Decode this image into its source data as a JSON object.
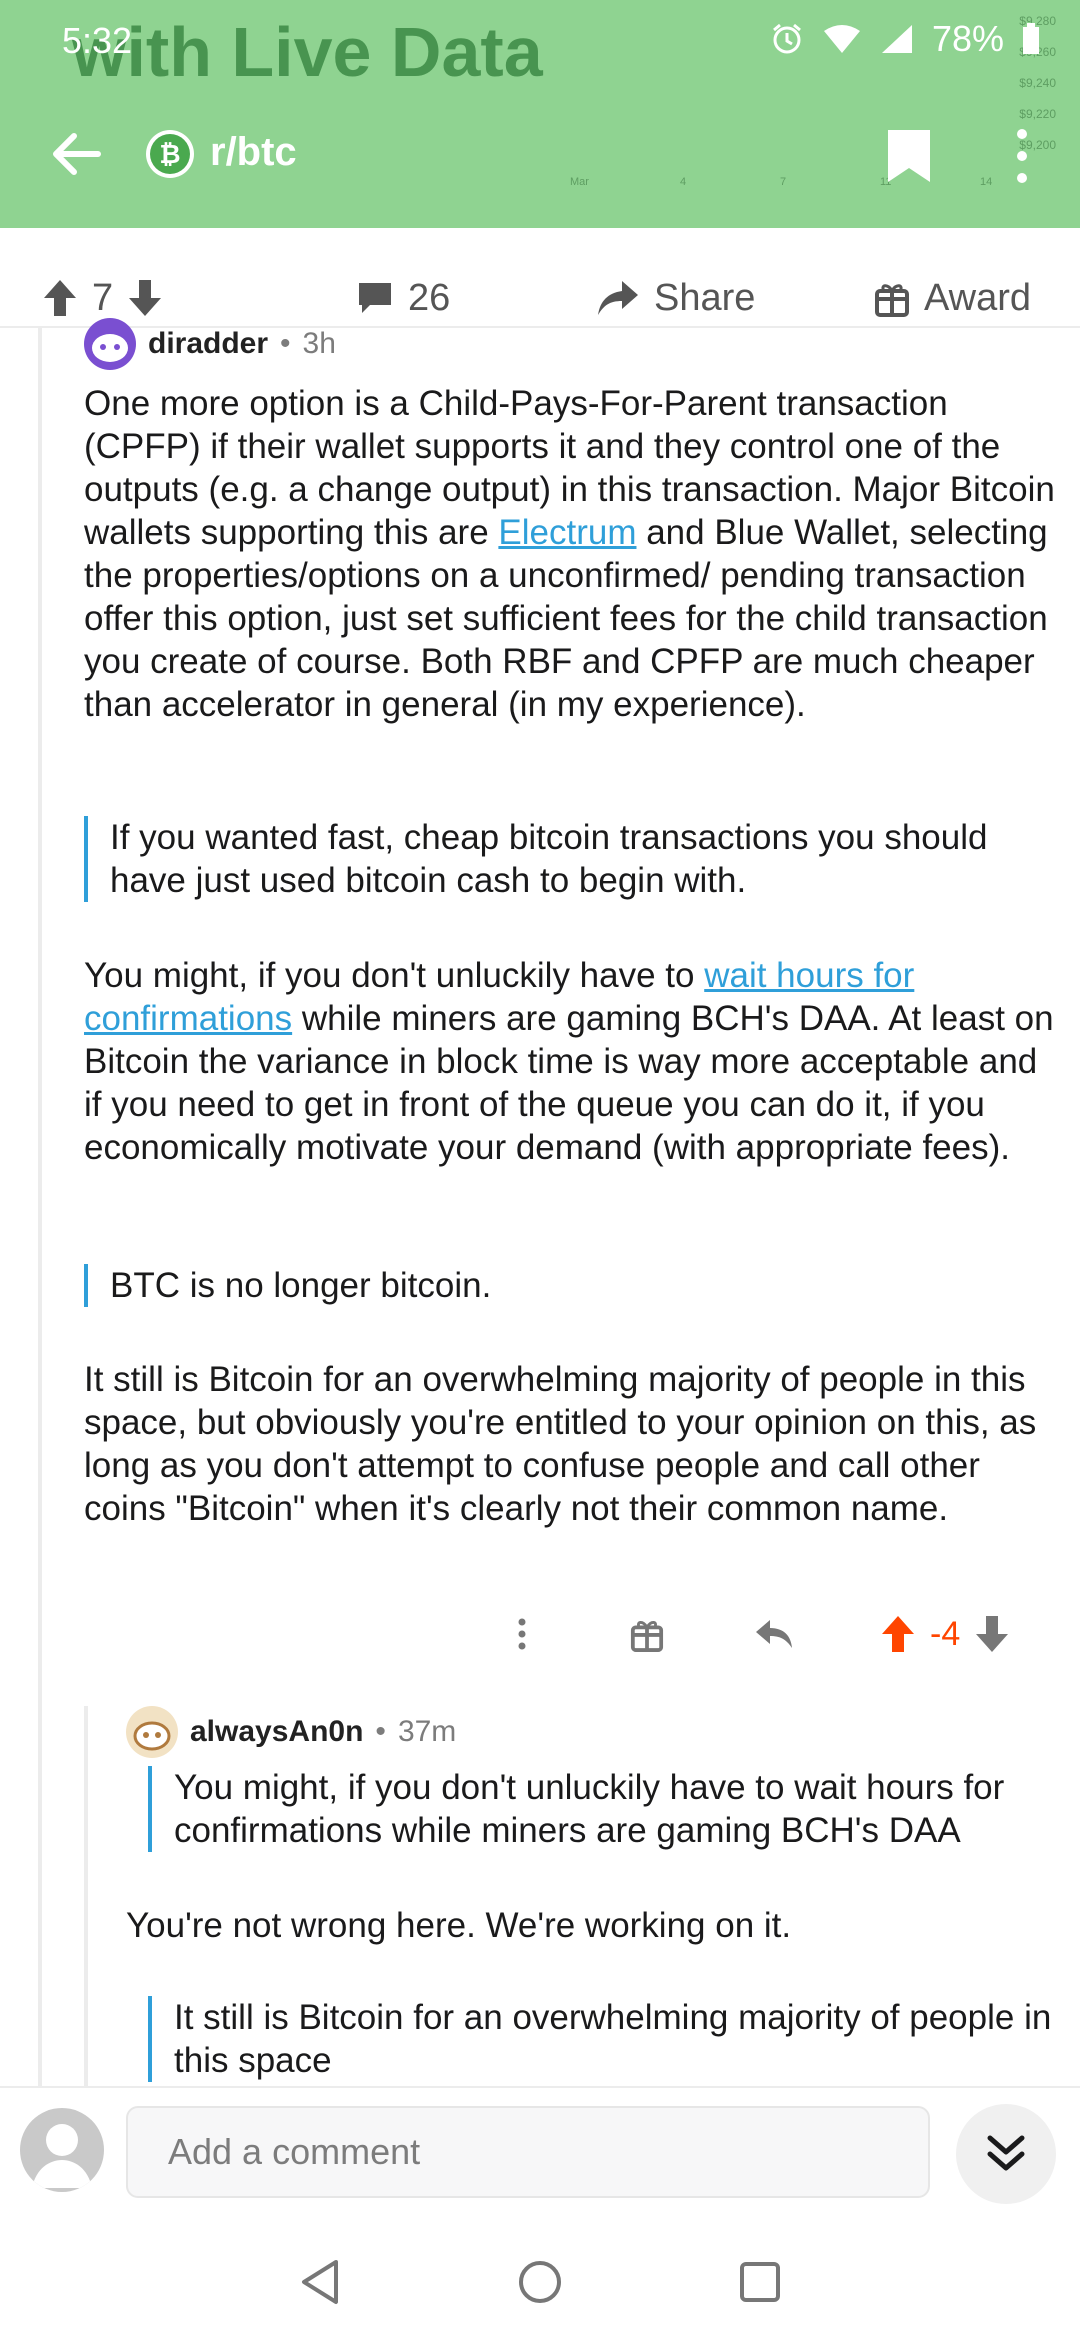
{
  "status_bar": {
    "time": "5:32",
    "battery": "78%"
  },
  "header": {
    "background_title": "with Live Data",
    "chart_ticks_y": [
      "$9,280",
      "$9,260",
      "$9,240",
      "$9,220",
      "$9,200"
    ],
    "chart_ticks_x": [
      "Mar",
      "4",
      "7",
      "11",
      "14"
    ],
    "subreddit": "r/btc",
    "subreddit_icon_glyph": "₿"
  },
  "post_actions": {
    "upvotes": "7",
    "comments": "26",
    "share_label": "Share",
    "award_label": "Award"
  },
  "comment": {
    "author": "diradder",
    "age": "3h",
    "p1_a": "One more option is a Child-Pays-For-Parent transaction (CPFP) if their wallet supports it and they control one of the outputs (e.g. a change output) in this transaction. Major Bitcoin wallets supporting this are ",
    "p1_link": "Electrum",
    "p1_b": " and Blue Wallet, selecting the properties/options on a unconfirmed/ pending transaction offer this option, just set sufficient fees for the child transaction you create of course. Both RBF and CPFP are much cheaper than accelerator in general (in my experience).",
    "quote1": "If you wanted fast, cheap bitcoin transactions you should have just used bitcoin cash to begin with.",
    "p2_a": "You might, if you don't unluckily have to ",
    "p2_link": "wait hours for confirmations",
    "p2_b": " while miners are gaming BCH's DAA. At least on Bitcoin the variance in block time is way more acceptable and if you need to get in front of the queue you can do it, if you economically motivate your demand (with appropriate fees).",
    "quote2": "BTC is no longer bitcoin.",
    "p3": "It still is Bitcoin for an overwhelming majority of people in this space, but obviously you're entitled to your opinion on this, as long as you don't attempt to confuse people and call other coins \"Bitcoin\" when it's clearly not their common name.",
    "score": "-4"
  },
  "reply": {
    "author": "alwaysAn0n",
    "age": "37m",
    "quote1": "You might, if you don't unluckily have to wait hours for confirmations while miners are gaming BCH's DAA",
    "text1": "You're not wrong here.  We're working on it.",
    "quote2": "It still is Bitcoin for an overwhelming majority of people in this space"
  },
  "composer": {
    "placeholder": "Add a comment"
  },
  "colors": {
    "header_green": "#8fd391",
    "link_blue": "#2f9fd9",
    "upvote_orange": "#ff4500"
  }
}
